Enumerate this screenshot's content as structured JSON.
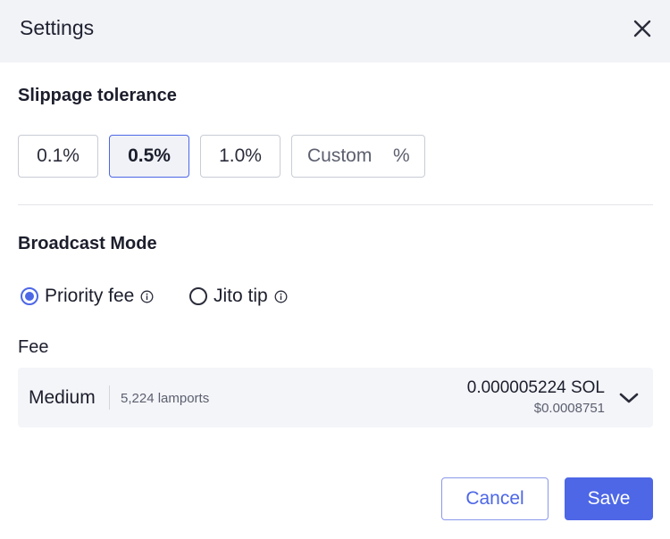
{
  "header": {
    "title": "Settings",
    "close_icon": "close-icon"
  },
  "slippage": {
    "title": "Slippage tolerance",
    "options": [
      "0.1%",
      "0.5%",
      "1.0%"
    ],
    "selected": "0.5%",
    "custom_placeholder": "Custom",
    "custom_value": "",
    "custom_suffix": "%"
  },
  "broadcast": {
    "title": "Broadcast Mode",
    "options": [
      {
        "label": "Priority fee",
        "checked": true,
        "icon": "info-icon"
      },
      {
        "label": "Jito tip",
        "checked": false,
        "icon": "info-icon"
      }
    ]
  },
  "fee": {
    "label": "Fee",
    "level": "Medium",
    "lamports": "5,224 lamports",
    "sol": "0.000005224 SOL",
    "usd": "$0.0008751",
    "dropdown_icon": "chevron-down-icon"
  },
  "actions": {
    "cancel_label": "Cancel",
    "save_label": "Save"
  },
  "colors": {
    "accent": "#4d67e6",
    "header_bg": "#f2f3f7",
    "fee_bg": "#f4f5f9"
  }
}
